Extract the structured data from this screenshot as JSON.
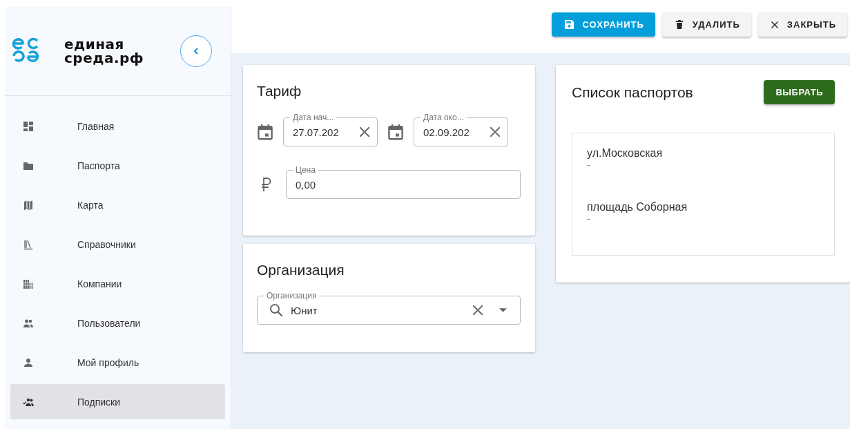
{
  "brand": {
    "lines": [
      "единая",
      "среда.рф"
    ]
  },
  "sidebar": {
    "items": [
      {
        "label": "Главная",
        "selected": false
      },
      {
        "label": "Паспорта",
        "selected": false
      },
      {
        "label": "Карта",
        "selected": false
      },
      {
        "label": "Справочники",
        "selected": false
      },
      {
        "label": "Компании",
        "selected": false
      },
      {
        "label": "Пользователи",
        "selected": false
      },
      {
        "label": "Мой профиль",
        "selected": false
      },
      {
        "label": "Подписки",
        "selected": true
      }
    ]
  },
  "toolbar": {
    "buttons": [
      {
        "label": "СОХРАНИТЬ",
        "kind": "save"
      },
      {
        "label": "УДАЛИТЬ",
        "kind": "delete"
      },
      {
        "label": "ЗАКРЫТЬ",
        "kind": "close"
      }
    ]
  },
  "tariff": {
    "title": "Тариф",
    "start_date": {
      "label": "Дата нач...",
      "value": "27.07.202"
    },
    "end_date": {
      "label": "Дата око...",
      "value": "02.09.202"
    },
    "price": {
      "label": "Цена",
      "value": "0,00"
    }
  },
  "organization": {
    "title": "Организация",
    "field": {
      "label": "Организация",
      "value": "Юнит"
    }
  },
  "passports": {
    "title": "Список паспортов",
    "button": "ВЫБРАТЬ",
    "items": [
      {
        "name": "ул.Московская",
        "detail": "-"
      },
      {
        "name": "площадь Соборная",
        "detail": "-"
      }
    ]
  }
}
